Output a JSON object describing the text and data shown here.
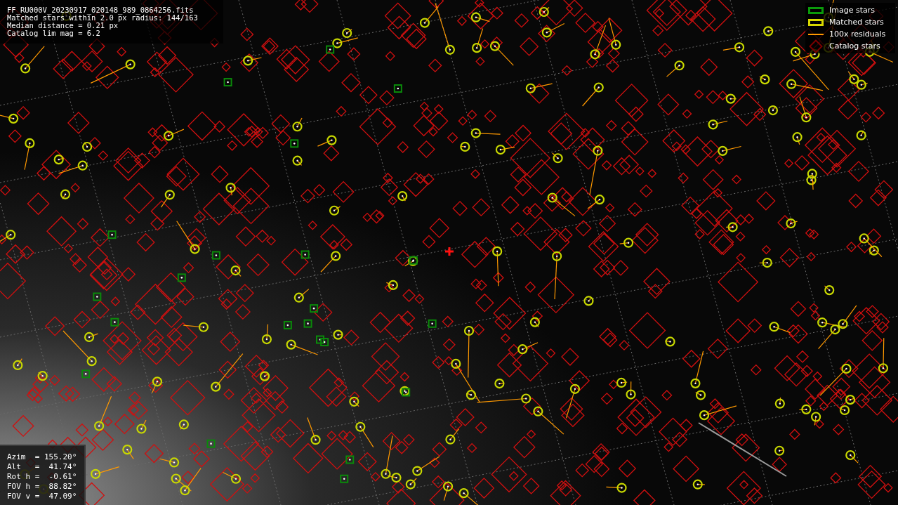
{
  "file_info": {
    "lines": [
      "FF_RU000V_20230917_020148_989_0864256.fits",
      "Matched stars within 2.0 px radius: 144/163",
      "Median distance = 0.21 px",
      "Catalog lim mag = 6.2"
    ]
  },
  "legend": [
    {
      "kind": "image",
      "label": "Image stars"
    },
    {
      "kind": "matched",
      "label": "Matched stars"
    },
    {
      "kind": "residual",
      "label": "100x residuals"
    },
    {
      "kind": "catalog",
      "label": "Catalog stars"
    }
  ],
  "pointing": {
    "lines": [
      "Azim  = 155.20°",
      "Alt   =  41.74°",
      "Rot h =  -0.61°",
      "FOV h =  88.82°",
      "FOV v =  47.09°"
    ]
  }
}
